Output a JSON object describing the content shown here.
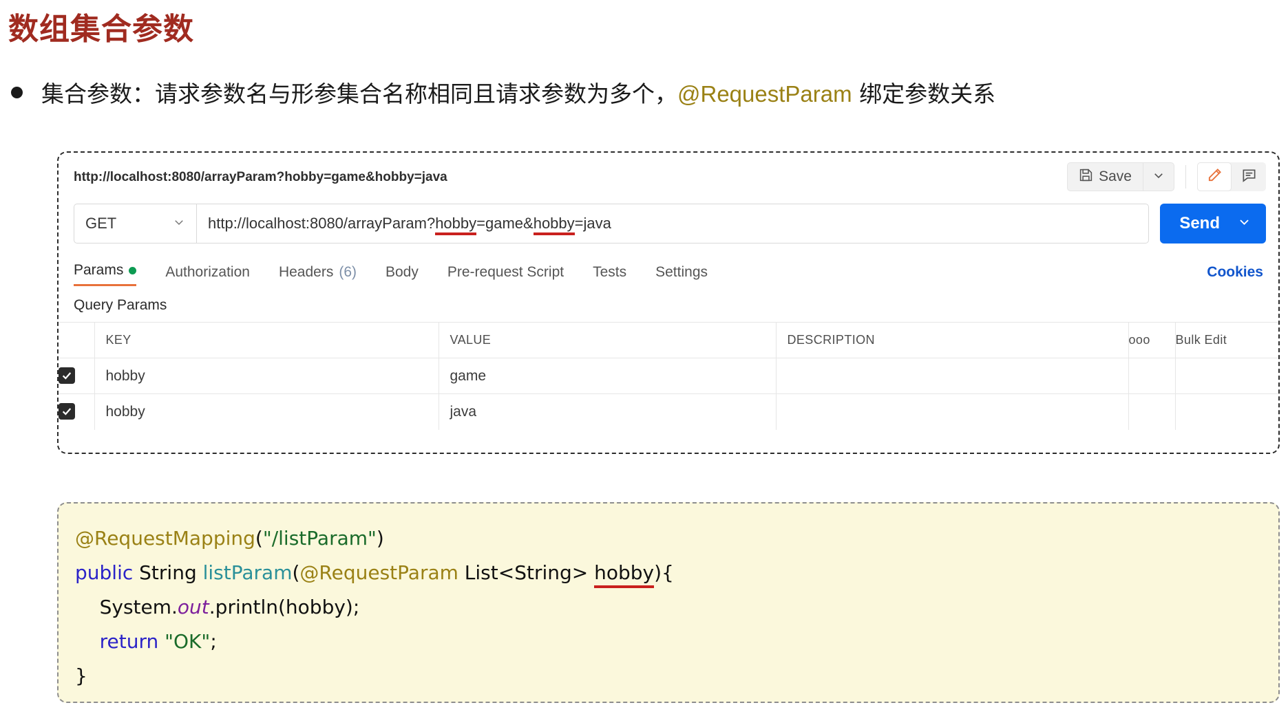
{
  "slide": {
    "title": "数组集合参数",
    "bullet": {
      "text_before": "集合参数：请求参数名与形参集合名称相同且请求参数为多个，",
      "annotation": "@RequestParam",
      "text_after": " 绑定参数关系"
    }
  },
  "postman": {
    "tab_title": "http://localhost:8080/arrayParam?hobby=game&hobby=java",
    "save_label": "Save",
    "save_icon": "floppy-disk-icon",
    "save_caret_icon": "chevron-down-icon",
    "edit_icon": "pencil-icon",
    "comment_icon": "comment-icon",
    "method": "GET",
    "method_caret_icon": "chevron-down-icon",
    "url": {
      "prefix": "http://localhost:8080/arrayParam?",
      "key1": "hobby",
      "mid": "=game&",
      "key2": "hobby",
      "suffix": "=java"
    },
    "send_label": "Send",
    "send_caret_icon": "chevron-down-icon",
    "tabs": [
      {
        "label": "Params",
        "dot": true,
        "active": true
      },
      {
        "label": "Authorization",
        "active": false
      },
      {
        "label": "Headers",
        "count": "(6)",
        "active": false
      },
      {
        "label": "Body",
        "active": false
      },
      {
        "label": "Pre-request Script",
        "active": false
      },
      {
        "label": "Tests",
        "active": false
      },
      {
        "label": "Settings",
        "active": false
      }
    ],
    "cookies_label": "Cookies",
    "query_params_title": "Query Params",
    "table": {
      "headers": {
        "key": "KEY",
        "value": "VALUE",
        "description": "DESCRIPTION",
        "dots": "ooo",
        "bulk_edit": "Bulk Edit"
      },
      "rows": [
        {
          "checked": true,
          "key": "hobby",
          "value": "game",
          "description": ""
        },
        {
          "checked": true,
          "key": "hobby",
          "value": "java",
          "description": ""
        }
      ]
    }
  },
  "code": {
    "line1": {
      "annotation": "@RequestMapping",
      "open": "(",
      "string": "\"/listParam\"",
      "close": ")"
    },
    "line2": {
      "kw": "public",
      "type": " String ",
      "fn": "listParam",
      "open": "(",
      "annotation": "@RequestParam",
      "param_type": " List<String> ",
      "param_name": "hobby",
      "close": "){"
    },
    "line3": {
      "obj": "System.",
      "field": "out",
      "call": ".println(hobby);"
    },
    "line4": {
      "kw": "return",
      "string": "\"OK\"",
      "semi": ";"
    },
    "line5": "}"
  },
  "colors": {
    "title": "#A02B20",
    "annotation": "#9a8115",
    "send_blue": "#0b6bef",
    "tab_accent": "#e8713a",
    "code_bg": "#FBF8DC",
    "underline_red": "#c9211e"
  }
}
